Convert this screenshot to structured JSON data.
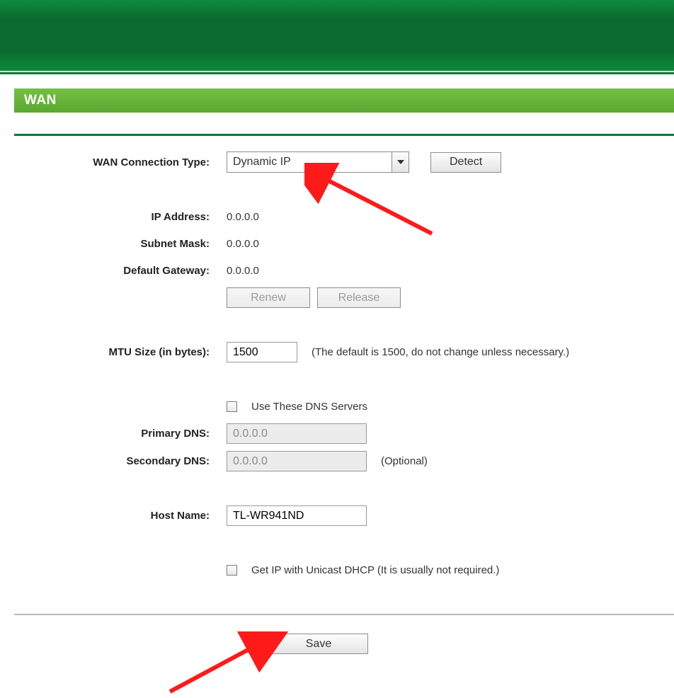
{
  "section": {
    "title": "WAN"
  },
  "connection": {
    "label": "WAN Connection Type:",
    "selected": "Dynamic IP",
    "detect_label": "Detect"
  },
  "ip": {
    "address_label": "IP Address:",
    "address_value": "0.0.0.0",
    "subnet_label": "Subnet Mask:",
    "subnet_value": "0.0.0.0",
    "gateway_label": "Default Gateway:",
    "gateway_value": "0.0.0.0",
    "renew_label": "Renew",
    "release_label": "Release"
  },
  "mtu": {
    "label": "MTU Size (in bytes):",
    "value": "1500",
    "note": "(The default is 1500, do not change unless necessary.)"
  },
  "dns": {
    "use_label": "Use These DNS Servers",
    "primary_label": "Primary DNS:",
    "primary_value": "0.0.0.0",
    "secondary_label": "Secondary DNS:",
    "secondary_value": "0.0.0.0",
    "optional": "(Optional)"
  },
  "host": {
    "label": "Host Name:",
    "value": "TL-WR941ND"
  },
  "unicast": {
    "label": "Get IP with Unicast DHCP (It is usually not required.)"
  },
  "actions": {
    "save": "Save"
  }
}
